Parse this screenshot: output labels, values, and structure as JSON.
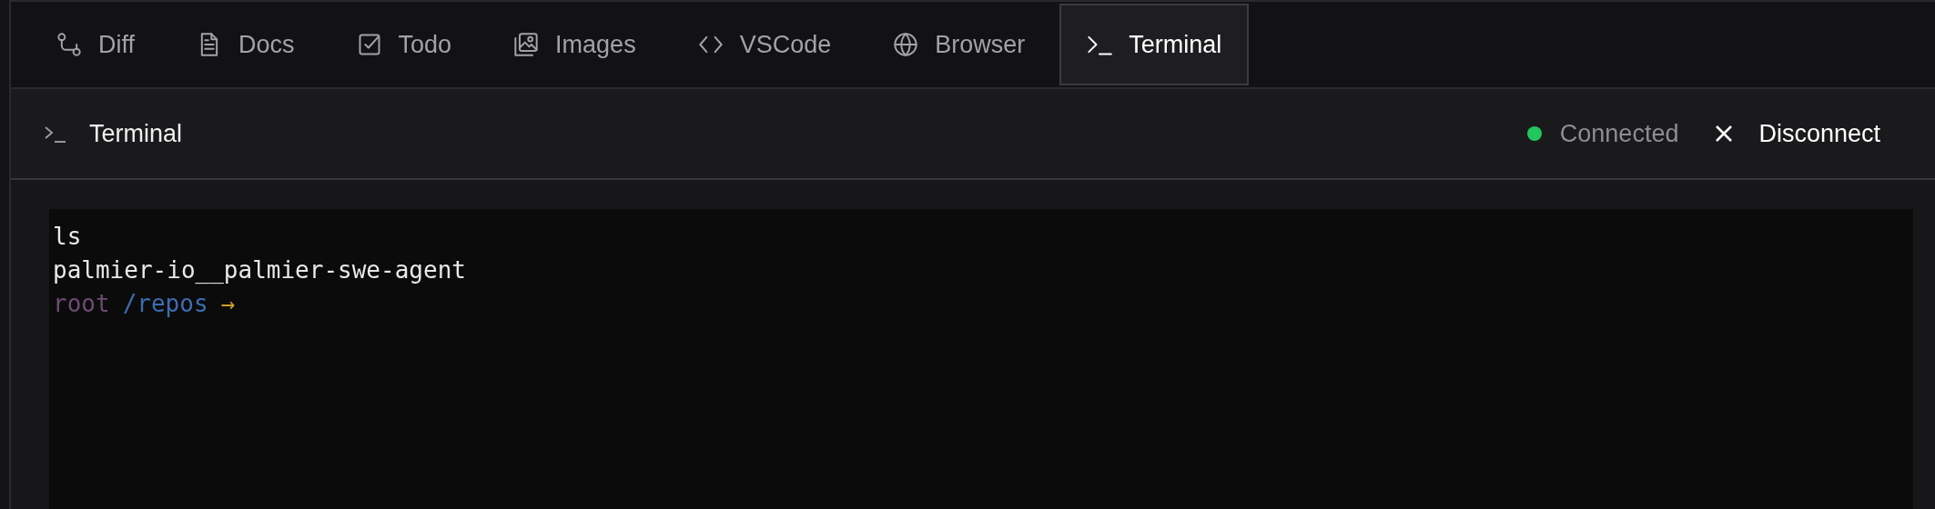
{
  "tabs": [
    {
      "label": "Diff",
      "kind": "diff",
      "selected": false
    },
    {
      "label": "Docs",
      "kind": "docs",
      "selected": false
    },
    {
      "label": "Todo",
      "kind": "todo",
      "selected": false
    },
    {
      "label": "Images",
      "kind": "images",
      "selected": false
    },
    {
      "label": "VSCode",
      "kind": "code",
      "selected": false
    },
    {
      "label": "Browser",
      "kind": "globe",
      "selected": false
    },
    {
      "label": "Terminal",
      "kind": "terminal",
      "selected": true
    }
  ],
  "panel": {
    "title": "Terminal",
    "status": {
      "label": "Connected",
      "color": "#22c55e"
    },
    "action": "Disconnect"
  },
  "terminal": {
    "lines": [
      {
        "kind": "output",
        "text": "ls"
      },
      {
        "kind": "output",
        "text": "palmier-io__palmier-swe-agent"
      },
      {
        "kind": "prompt",
        "user": "root",
        "path": "/repos",
        "arrow": "→"
      }
    ]
  }
}
